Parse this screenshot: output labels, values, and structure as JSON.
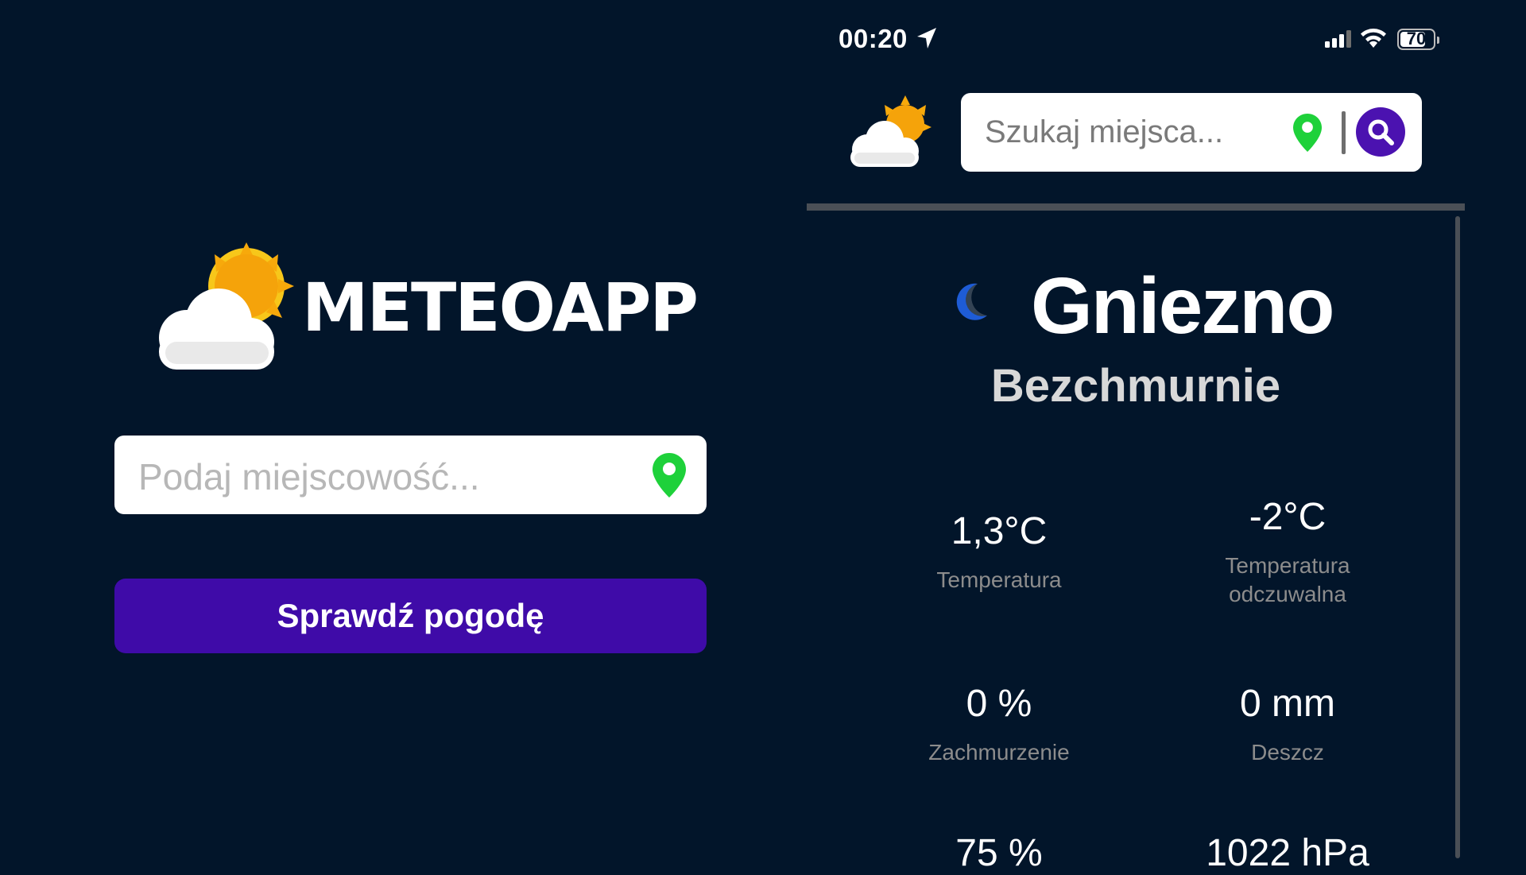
{
  "brand": {
    "name": "METEOAPP"
  },
  "left_form": {
    "city_placeholder": "Podaj miejscowość...",
    "check_button": "Sprawdź pogodę"
  },
  "status_bar": {
    "time": "00:20",
    "battery": "70"
  },
  "header": {
    "search_placeholder": "Szukaj miejsca..."
  },
  "weather": {
    "city": "Gniezno",
    "condition": "Bezchmurnie",
    "icon": "moon-icon",
    "stats": [
      {
        "value": "1,3°C",
        "label": "Temperatura"
      },
      {
        "value": "-2°C",
        "label": "Temperatura odczuwalna"
      },
      {
        "value": "0 %",
        "label": "Zachmurzenie"
      },
      {
        "value": "0 mm",
        "label": "Deszcz"
      },
      {
        "value": "75 %",
        "label": ""
      },
      {
        "value": "1022 hPa",
        "label": ""
      }
    ]
  },
  "colors": {
    "background": "#02152a",
    "accent": "#3f0ba8",
    "pin": "#1ed13a",
    "sun": "#f7a90b"
  }
}
